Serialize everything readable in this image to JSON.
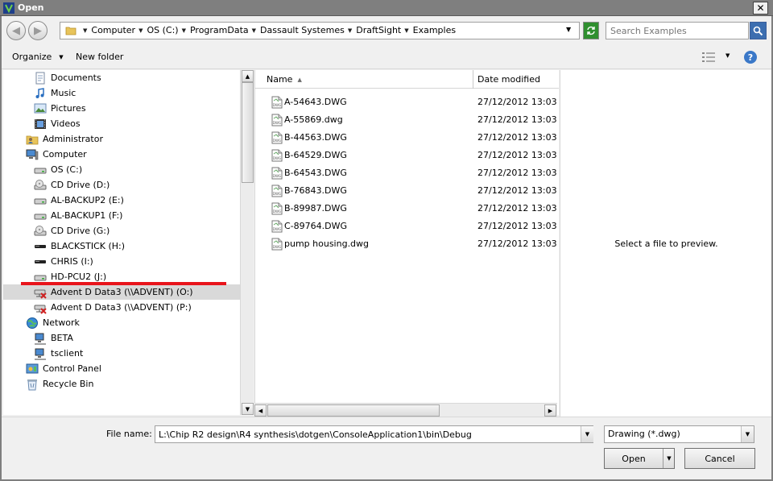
{
  "window": {
    "title": "Open",
    "close_glyph": "✕"
  },
  "nav": {
    "back_glyph": "◀",
    "forward_glyph": "▶",
    "breadcrumbs": [
      "Computer",
      "OS (C:)",
      "ProgramData",
      "Dassault Systemes",
      "DraftSight",
      "Examples"
    ],
    "search_placeholder": "Search Examples"
  },
  "toolbar": {
    "organize_label": "Organize",
    "new_folder_label": "New folder",
    "help_glyph": "?"
  },
  "nav_pane": {
    "items": [
      {
        "label": "Documents",
        "icon": "documents-icon",
        "indent": 1
      },
      {
        "label": "Music",
        "icon": "music-icon",
        "indent": 1
      },
      {
        "label": "Pictures",
        "icon": "pictures-icon",
        "indent": 1
      },
      {
        "label": "Videos",
        "icon": "videos-icon",
        "indent": 1
      },
      {
        "label": "Administrator",
        "icon": "user-folder-icon",
        "indent": 0
      },
      {
        "label": "Computer",
        "icon": "computer-icon",
        "indent": 0
      },
      {
        "label": "OS (C:)",
        "icon": "hard-drive-icon",
        "indent": 1
      },
      {
        "label": "CD Drive (D:)",
        "icon": "cd-drive-icon",
        "indent": 1
      },
      {
        "label": "AL-BACKUP2 (E:)",
        "icon": "hard-drive-icon",
        "indent": 1
      },
      {
        "label": "AL-BACKUP1 (F:)",
        "icon": "hard-drive-icon",
        "indent": 1
      },
      {
        "label": "CD Drive (G:)",
        "icon": "cd-drive-icon",
        "indent": 1
      },
      {
        "label": "BLACKSTICK (H:)",
        "icon": "usb-drive-icon",
        "indent": 1
      },
      {
        "label": "CHRIS (I:)",
        "icon": "usb-drive-icon",
        "indent": 1
      },
      {
        "label": "HD-PCU2 (J:)",
        "icon": "hard-drive-icon",
        "indent": 1
      },
      {
        "label": "Advent D Data3 (\\\\ADVENT) (O:)",
        "icon": "disconnected-network-drive-icon",
        "indent": 1,
        "selected": true
      },
      {
        "label": "Advent D Data3 (\\\\ADVENT) (P:)",
        "icon": "disconnected-network-drive-icon",
        "indent": 1
      },
      {
        "label": "Network",
        "icon": "network-icon",
        "indent": 0
      },
      {
        "label": "BETA",
        "icon": "network-computer-icon",
        "indent": 1
      },
      {
        "label": "tsclient",
        "icon": "network-computer-icon",
        "indent": 1
      },
      {
        "label": "Control Panel",
        "icon": "control-panel-icon",
        "indent": 0
      },
      {
        "label": "Recycle Bin",
        "icon": "recycle-bin-icon",
        "indent": 0
      }
    ]
  },
  "file_list": {
    "columns": {
      "name": "Name",
      "date": "Date modified"
    },
    "files": [
      {
        "name": "A-54643.DWG",
        "date": "27/12/2012 13:03"
      },
      {
        "name": "A-55869.dwg",
        "date": "27/12/2012 13:03"
      },
      {
        "name": "B-44563.DWG",
        "date": "27/12/2012 13:03"
      },
      {
        "name": "B-64529.DWG",
        "date": "27/12/2012 13:03"
      },
      {
        "name": "B-64543.DWG",
        "date": "27/12/2012 13:03"
      },
      {
        "name": "B-76843.DWG",
        "date": "27/12/2012 13:03"
      },
      {
        "name": "B-89987.DWG",
        "date": "27/12/2012 13:03"
      },
      {
        "name": "C-89764.DWG",
        "date": "27/12/2012 13:03"
      },
      {
        "name": "pump housing.dwg",
        "date": "27/12/2012 13:03"
      }
    ]
  },
  "preview": {
    "text": "Select a file to preview."
  },
  "bottom": {
    "filename_label": "File name:",
    "filename_value": "L:\\Chip R2 design\\R4 synthesis\\dotgen\\ConsoleApplication1\\bin\\Debug",
    "filetype_value": "Drawing (*.dwg)",
    "open_label": "Open",
    "cancel_label": "Cancel"
  },
  "colors": {
    "title_bar": "#7f7f7f",
    "selection": "#d9d9d9",
    "annotation_red": "#e8141b"
  }
}
